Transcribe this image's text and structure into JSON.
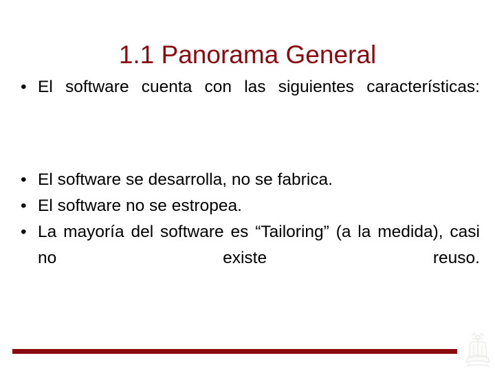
{
  "slide": {
    "title": "1.1 Panorama General",
    "bullet_marker": "•",
    "groups": [
      {
        "id": "intro",
        "items": [
          {
            "text": "El software cuenta con las siguientes características:",
            "justified": true
          }
        ]
      },
      {
        "id": "characteristics",
        "items": [
          {
            "text": "El software se desarrolla, no se fabrica.",
            "justified": false
          },
          {
            "text": "El software no se estropea.",
            "justified": false
          },
          {
            "text": "La mayoría del software es “Tailoring” (a la medida), casi no existe reuso.",
            "justified": true
          }
        ]
      }
    ],
    "decoration": {
      "rule_color": "#8b0a10",
      "title_color": "#8b0a10",
      "text_color": "#000000",
      "background_color": "#ffffff",
      "crest_label": "university-crest-watermark"
    }
  }
}
